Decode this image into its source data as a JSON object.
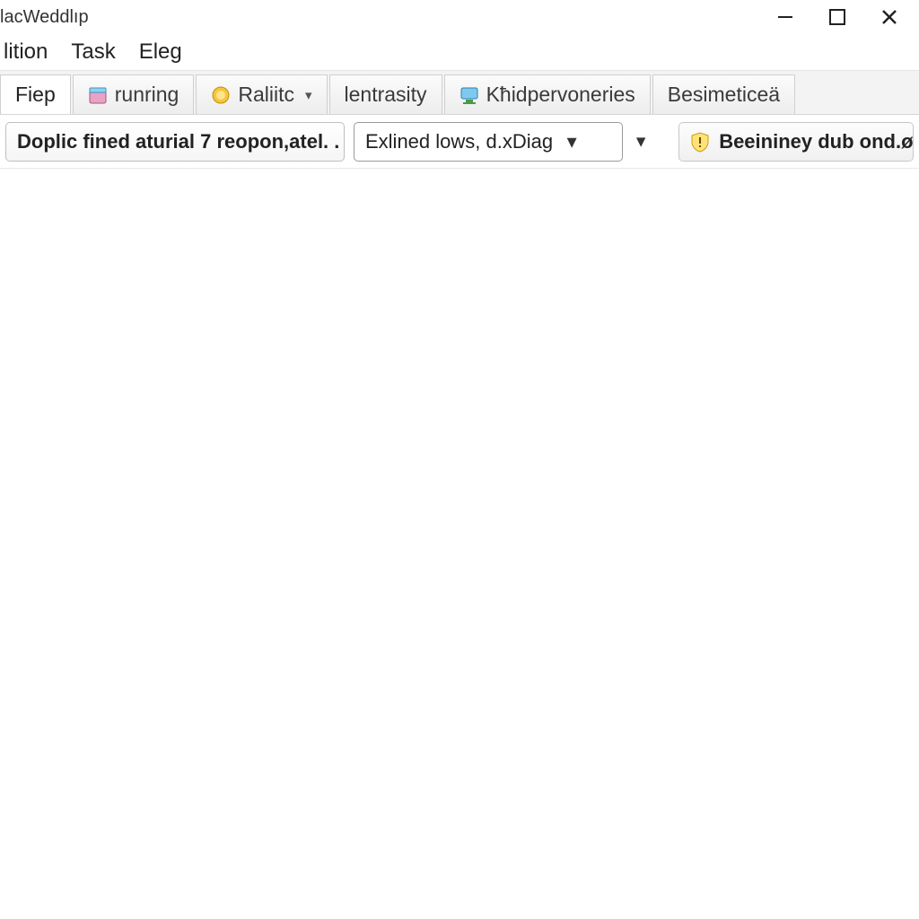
{
  "window": {
    "title": "lacWeddlıp"
  },
  "menu": {
    "items": [
      "lition",
      "Task",
      "Eleg"
    ]
  },
  "tabs": [
    {
      "label": "Fiep",
      "icon": null,
      "active": true,
      "dropdown": false
    },
    {
      "label": "runring",
      "icon": "box",
      "active": false,
      "dropdown": false
    },
    {
      "label": "Raliitc",
      "icon": "coin",
      "active": false,
      "dropdown": true
    },
    {
      "label": "lentrasity",
      "icon": null,
      "active": false,
      "dropdown": false
    },
    {
      "label": "Kħidpervoneries",
      "icon": "monitor",
      "active": false,
      "dropdown": false
    },
    {
      "label": "Besimeticeä",
      "icon": null,
      "active": false,
      "dropdown": false
    }
  ],
  "toolbar": {
    "status_text": "Doplic fined aturial 7 reopon,atel. .",
    "combo_value": "Exlined lows, d.xDiag",
    "info_button": "Beeininey dub ond.ør"
  },
  "icons": {
    "box": "box-icon",
    "coin": "coin-icon",
    "monitor": "monitor-icon",
    "shield": "shield-warning-icon"
  }
}
